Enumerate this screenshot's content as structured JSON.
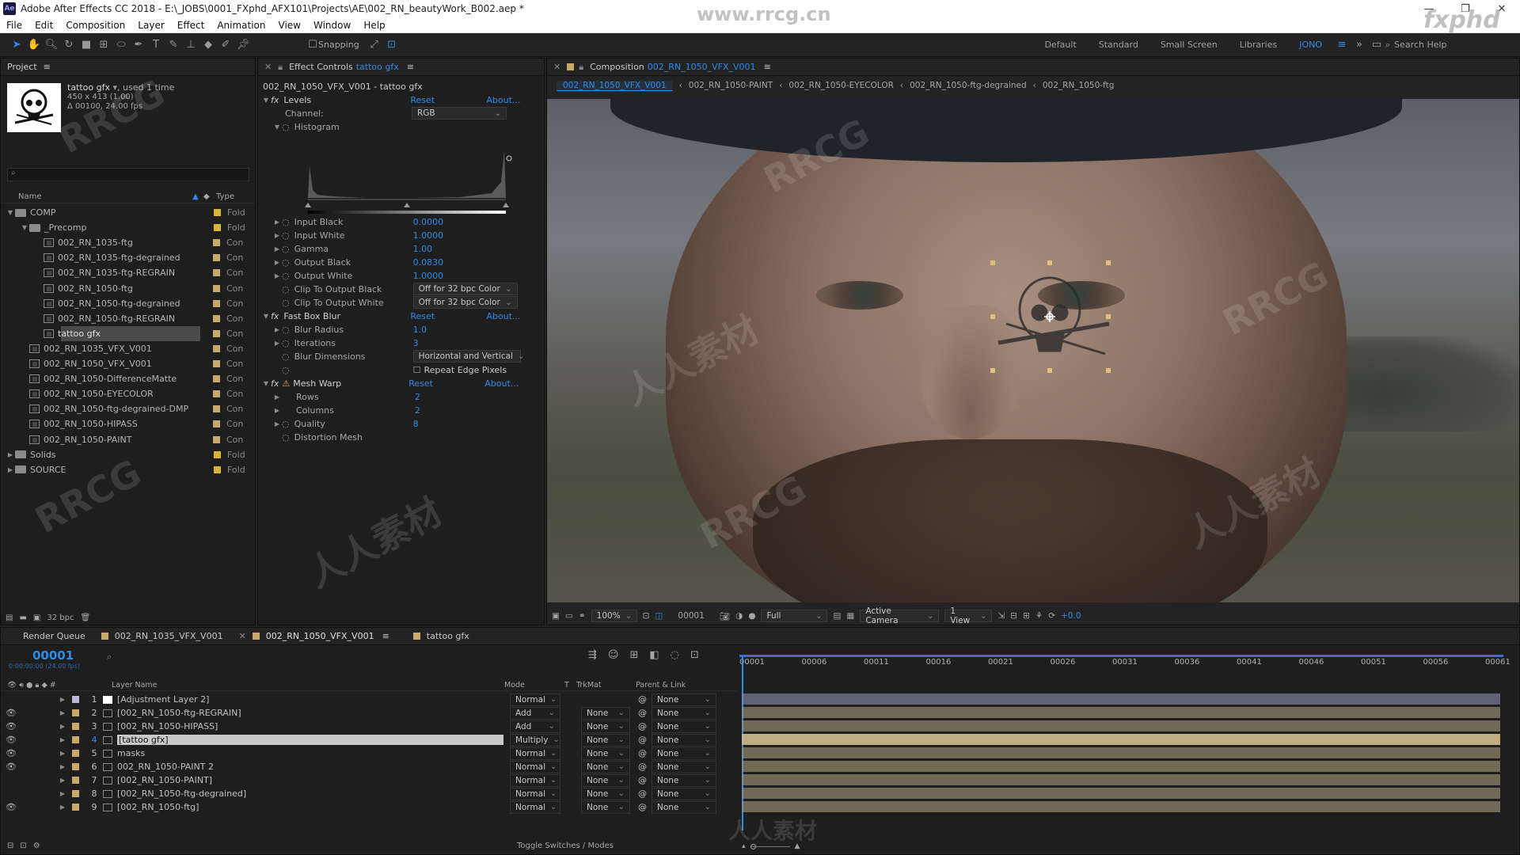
{
  "window": {
    "title": "Adobe After Effects CC 2018 - E:\\_JOBS\\0001_FXphd_AFX101\\Projects\\AE\\002_RN_beautyWork_B002.aep *",
    "app_badge": "Ae"
  },
  "menu": [
    "File",
    "Edit",
    "Composition",
    "Layer",
    "Effect",
    "Animation",
    "View",
    "Window",
    "Help"
  ],
  "toolbar": {
    "snapping": "Snapping",
    "workspaces": [
      "Default",
      "Standard",
      "Small Screen",
      "Libraries",
      "JONO"
    ],
    "active_workspace": "JONO",
    "search_help": "Search Help"
  },
  "watermarks": {
    "site": "www.rrcg.cn",
    "brand": "fxphd",
    "rrcg": "RRCG",
    "cn": "人人素材"
  },
  "project": {
    "tab": "Project",
    "selected": {
      "name": "tattoo gfx",
      "used": ", used 1 time",
      "size": "450 x 413 (1.00)",
      "duration": "Δ 00100, 24.00 fps"
    },
    "search_placeholder": "",
    "col_name": "Name",
    "col_type": "Type",
    "items": [
      {
        "name": "COMP",
        "type": "Fold",
        "kind": "folder",
        "level": 0,
        "open": true,
        "color": "#d9b43a"
      },
      {
        "name": "_Precomp",
        "type": "Fold",
        "kind": "folder",
        "level": 1,
        "open": true,
        "color": "#d9b43a"
      },
      {
        "name": "002_RN_1035-ftg",
        "type": "Con",
        "kind": "comp",
        "level": 2,
        "color": "#c9a96a"
      },
      {
        "name": "002_RN_1035-ftg-degrained",
        "type": "Con",
        "kind": "comp",
        "level": 2,
        "color": "#c9a96a"
      },
      {
        "name": "002_RN_1035-ftg-REGRAIN",
        "type": "Con",
        "kind": "comp",
        "level": 2,
        "color": "#c9a96a"
      },
      {
        "name": "002_RN_1050-ftg",
        "type": "Con",
        "kind": "comp",
        "level": 2,
        "color": "#c9a96a"
      },
      {
        "name": "002_RN_1050-ftg-degrained",
        "type": "Con",
        "kind": "comp",
        "level": 2,
        "color": "#c9a96a"
      },
      {
        "name": "002_RN_1050-ftg-REGRAIN",
        "type": "Con",
        "kind": "comp",
        "level": 2,
        "color": "#c9a96a"
      },
      {
        "name": "tattoo gfx",
        "type": "Con",
        "kind": "comp",
        "level": 2,
        "color": "#c9a96a",
        "selected": true
      },
      {
        "name": "002_RN_1035_VFX_V001",
        "type": "Con",
        "kind": "comp",
        "level": 1,
        "color": "#c9a96a"
      },
      {
        "name": "002_RN_1050_VFX_V001",
        "type": "Con",
        "kind": "comp",
        "level": 1,
        "color": "#c9a96a"
      },
      {
        "name": "002_RN_1050-DifferenceMatte",
        "type": "Con",
        "kind": "comp",
        "level": 1,
        "color": "#c9a96a"
      },
      {
        "name": "002_RN_1050-EYECOLOR",
        "type": "Con",
        "kind": "comp",
        "level": 1,
        "color": "#c9a96a"
      },
      {
        "name": "002_RN_1050-ftg-degrained-DMP",
        "type": "Con",
        "kind": "comp",
        "level": 1,
        "color": "#c9a96a"
      },
      {
        "name": "002_RN_1050-HIPASS",
        "type": "Con",
        "kind": "comp",
        "level": 1,
        "color": "#c9a96a"
      },
      {
        "name": "002_RN_1050-PAINT",
        "type": "Con",
        "kind": "comp",
        "level": 1,
        "color": "#c9a96a"
      },
      {
        "name": "Solids",
        "type": "Fold",
        "kind": "folder",
        "level": 0,
        "open": false,
        "color": "#d9b43a"
      },
      {
        "name": "SOURCE",
        "type": "Fold",
        "kind": "folder",
        "level": 0,
        "open": false,
        "color": "#d9b43a"
      }
    ],
    "bpc": "32 bpc"
  },
  "effects": {
    "tab_prefix": "Effect Controls",
    "tab_layer": "tattoo gfx",
    "breadcrumb": "002_RN_1050_VFX_V001 - tattoo gfx",
    "reset": "Reset",
    "about": "About...",
    "levels": {
      "name": "Levels",
      "channel_label": "Channel:",
      "channel": "RGB",
      "histogram": "Histogram",
      "props": [
        {
          "label": "Input Black",
          "value": "0.0000"
        },
        {
          "label": "Input White",
          "value": "1.0000"
        },
        {
          "label": "Gamma",
          "value": "1.00"
        },
        {
          "label": "Output Black",
          "value": "0.0830"
        },
        {
          "label": "Output White",
          "value": "1.0000"
        }
      ],
      "clip_black_label": "Clip To Output Black",
      "clip_black": "Off for 32 bpc Color",
      "clip_white_label": "Clip To Output White",
      "clip_white": "Off for 32 bpc Color"
    },
    "blur": {
      "name": "Fast Box Blur",
      "radius_label": "Blur Radius",
      "radius": "1.0",
      "iter_label": "Iterations",
      "iter": "3",
      "dim_label": "Blur Dimensions",
      "dim": "Horizontal and Vertical",
      "repeat": "Repeat Edge Pixels"
    },
    "mesh": {
      "name": "Mesh Warp",
      "rows_label": "Rows",
      "rows": "2",
      "cols_label": "Columns",
      "cols": "2",
      "quality_label": "Quality",
      "quality": "8",
      "distortion": "Distortion Mesh"
    }
  },
  "composition": {
    "tab_prefix": "Composition",
    "tab_name": "002_RN_1050_VFX_V001",
    "crumbs": [
      "002_RN_1050_VFX_V001",
      "002_RN_1050-PAINT",
      "002_RN_1050-EYECOLOR",
      "002_RN_1050-ftg-degrained",
      "002_RN_1050-ftg"
    ],
    "zoom": "100%",
    "frame": "00001",
    "resolution": "Full",
    "camera": "Active Camera",
    "views": "1 View",
    "exposure": "+0.0"
  },
  "timeline": {
    "tabs": [
      "Render Queue",
      "002_RN_1035_VFX_V001",
      "002_RN_1050_VFX_V001",
      "tattoo gfx"
    ],
    "active_tab": "002_RN_1050_VFX_V001",
    "timecode": "00001",
    "timecode_sub": "0:00:00:00 (24.00 fps)",
    "col_layer": "Layer Name",
    "col_mode": "Mode",
    "col_t": "T",
    "col_trk": "TrkMat",
    "col_parent": "Parent & Link",
    "ruler": [
      "00001",
      "00006",
      "00011",
      "00016",
      "00021",
      "00026",
      "00031",
      "00036",
      "00041",
      "00046",
      "00051",
      "00056",
      "00061"
    ],
    "layers": [
      {
        "num": "1",
        "name": "[Adjustment Layer 2]",
        "mode": "Normal",
        "trk": "",
        "parent": "None",
        "color": "#b8b8d8",
        "icon": "solid",
        "eye": false
      },
      {
        "num": "2",
        "name": "[002_RN_1050-ftg-REGRAIN]",
        "mode": "Add",
        "trk": "None",
        "parent": "None",
        "color": "#c9a96a",
        "icon": "comp",
        "eye": true
      },
      {
        "num": "3",
        "name": "[002_RN_1050-HIPASS]",
        "mode": "Add",
        "trk": "None",
        "parent": "None",
        "color": "#c9a96a",
        "icon": "comp",
        "eye": true
      },
      {
        "num": "4",
        "name": "[tattoo gfx]",
        "mode": "Multiply",
        "trk": "None",
        "parent": "None",
        "color": "#c9a96a",
        "icon": "comp",
        "eye": true,
        "selected": true
      },
      {
        "num": "5",
        "name": "masks",
        "mode": "Normal",
        "trk": "None",
        "parent": "None",
        "color": "#c9a96a",
        "icon": "comp",
        "eye": true
      },
      {
        "num": "6",
        "name": "002_RN_1050-PAINT 2",
        "mode": "Normal",
        "trk": "None",
        "parent": "None",
        "color": "#c9a96a",
        "icon": "comp",
        "eye": true
      },
      {
        "num": "7",
        "name": "[002_RN_1050-PAINT]",
        "mode": "Normal",
        "trk": "None",
        "parent": "None",
        "color": "#c9a96a",
        "icon": "comp",
        "eye": false
      },
      {
        "num": "8",
        "name": "[002_RN_1050-ftg-degrained]",
        "mode": "Normal",
        "trk": "None",
        "parent": "None",
        "color": "#c9a96a",
        "icon": "comp",
        "eye": false
      },
      {
        "num": "9",
        "name": "[002_RN_1050-ftg]",
        "mode": "Normal",
        "trk": "None",
        "parent": "None",
        "color": "#c9a96a",
        "icon": "comp",
        "eye": true
      }
    ],
    "toggle": "Toggle Switches / Modes"
  }
}
